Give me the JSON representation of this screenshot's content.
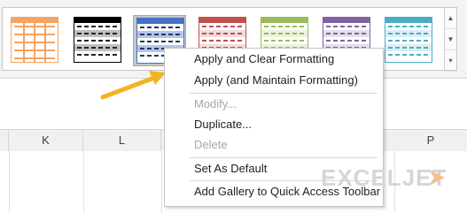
{
  "ribbon": {
    "table_styles": [
      {
        "name": "orange-style",
        "color": "#f4a460",
        "lines": "#f4a460"
      },
      {
        "name": "black-style",
        "color": "#000000",
        "lines": "#222222"
      },
      {
        "name": "blue-style-selected",
        "color": "#4472c4",
        "lines": "#1f3864"
      },
      {
        "name": "red-style",
        "color": "#c0504d",
        "lines": "#c0504d"
      },
      {
        "name": "green-style",
        "color": "#9bbb59",
        "lines": "#9bbb59"
      },
      {
        "name": "purple-style",
        "color": "#8064a2",
        "lines": "#8064a2"
      },
      {
        "name": "teal-style",
        "color": "#4bacc6",
        "lines": "#4bacc6"
      }
    ],
    "scroll_up_icon": "▲",
    "scroll_down_icon": "▼",
    "more_icon": "▾"
  },
  "columns": [
    "K",
    "L",
    "P"
  ],
  "context_menu": {
    "items": [
      {
        "label": "Apply and Clear Formatting",
        "enabled": true
      },
      {
        "label": "Apply (and Maintain Formatting)",
        "enabled": true
      },
      {
        "label": "Modify...",
        "enabled": false
      },
      {
        "label": "Duplicate...",
        "enabled": true
      },
      {
        "label": "Delete",
        "enabled": false
      },
      {
        "label": "Set As Default",
        "enabled": true
      },
      {
        "label": "Add Gallery to Quick Access Toolbar",
        "enabled": true
      }
    ]
  },
  "watermark": "EXCELJET",
  "arrow_color": "#f5b324"
}
